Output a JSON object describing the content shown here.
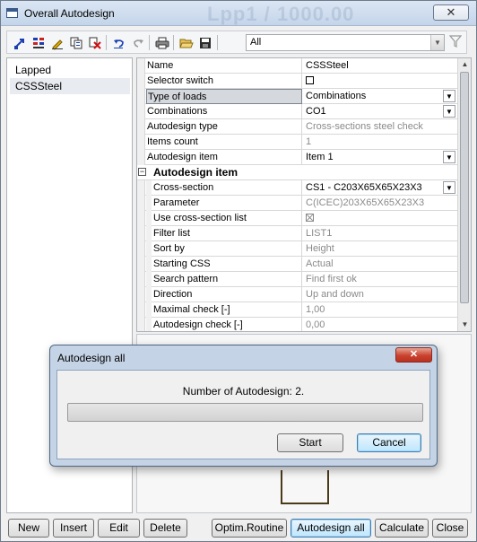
{
  "window": {
    "title": "Overall Autodesign",
    "title_watermark": "Lpp1 / 1000.00",
    "close_glyph": "✕"
  },
  "toolbar": {
    "icons": [
      "pointer-tool-icon",
      "grid-icon",
      "edit-pencil-icon",
      "copy-icon",
      "delete-icon",
      "undo-icon",
      "redo-icon",
      "print-icon",
      "open-folder-icon",
      "save-icon"
    ],
    "filter_value": "All",
    "filter_icon": "funnel-icon"
  },
  "list": {
    "items": [
      {
        "label": "Lapped",
        "selected": false
      },
      {
        "label": "CSSSteel",
        "selected": true
      }
    ]
  },
  "properties": {
    "rows": [
      {
        "name": "Name",
        "value": "CSSSteel"
      },
      {
        "name": "Selector switch",
        "value": ""
      },
      {
        "name": "Type of loads",
        "value": "Combinations"
      },
      {
        "name": "Combinations",
        "value": "CO1"
      },
      {
        "name": "Autodesign type",
        "value": "Cross-sections steel check"
      },
      {
        "name": "Items count",
        "value": "1"
      },
      {
        "name": "Autodesign item",
        "value": "Item 1"
      }
    ],
    "group_label": "Autodesign item",
    "group_toggle": "⊟",
    "sub_rows": [
      {
        "name": "Cross-section",
        "value": "CS1 - C203X65X65X23X3"
      },
      {
        "name": "Parameter",
        "value": "C(ICEC)203X65X65X23X3"
      },
      {
        "name": "Use cross-section list",
        "value": ""
      },
      {
        "name": "Filter list",
        "value": "LIST1"
      },
      {
        "name": "Sort by",
        "value": "Height"
      },
      {
        "name": "Starting CSS",
        "value": "Actual"
      },
      {
        "name": "Search pattern",
        "value": "Find first ok"
      },
      {
        "name": "Direction",
        "value": "Up and down"
      },
      {
        "name": "Maximal check [-]",
        "value": "1,00"
      },
      {
        "name": "Autodesign check [-]",
        "value": "0,00"
      }
    ]
  },
  "buttons": {
    "new": "New",
    "insert": "Insert",
    "edit": "Edit",
    "delete": "Delete",
    "optim": "Optim.Routine",
    "autodesign_all": "Autodesign all",
    "calculate": "Calculate",
    "close": "Close"
  },
  "dialog": {
    "title": "Autodesign all",
    "close_glyph": "✕",
    "message": "Number of Autodesign: 2.",
    "progress": 0,
    "start": "Start",
    "cancel": "Cancel"
  },
  "colors": {
    "progress_fill": "#3fb84a",
    "dialog_close": "#c9422e"
  }
}
